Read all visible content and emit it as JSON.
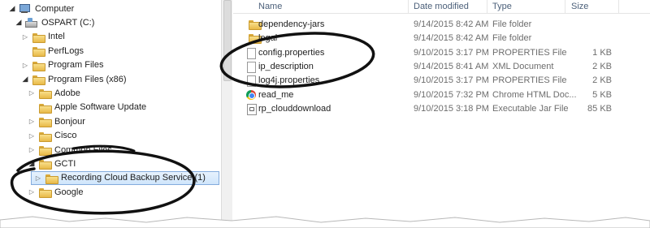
{
  "tree": {
    "items": [
      {
        "label": "Computer",
        "icon": "computer-icon",
        "arrow": "open",
        "indent": 0
      },
      {
        "label": "OSPART (C:)",
        "icon": "drive-icon",
        "arrow": "open",
        "indent": 1
      },
      {
        "label": "Intel",
        "icon": "folder-icon",
        "arrow": "closed",
        "indent": 2
      },
      {
        "label": "PerfLogs",
        "icon": "folder-icon",
        "arrow": "none",
        "indent": 2
      },
      {
        "label": "Program Files",
        "icon": "folder-icon",
        "arrow": "closed",
        "indent": 2
      },
      {
        "label": "Program Files (x86)",
        "icon": "folder-icon",
        "arrow": "open",
        "indent": 2
      },
      {
        "label": "Adobe",
        "icon": "folder-icon",
        "arrow": "closed",
        "indent": 3
      },
      {
        "label": "Apple Software Update",
        "icon": "folder-icon",
        "arrow": "none",
        "indent": 3
      },
      {
        "label": "Bonjour",
        "icon": "folder-icon",
        "arrow": "closed",
        "indent": 3
      },
      {
        "label": "Cisco",
        "icon": "folder-icon",
        "arrow": "closed",
        "indent": 3
      },
      {
        "label": "Common Files",
        "icon": "folder-icon",
        "arrow": "closed",
        "indent": 3
      },
      {
        "label": "GCTI",
        "icon": "folder-icon",
        "arrow": "open",
        "indent": 3
      },
      {
        "label": "Recording Cloud Backup Service (1)",
        "icon": "folder-icon",
        "arrow": "closed",
        "indent": 4,
        "selected": true
      },
      {
        "label": "Google",
        "icon": "folder-icon",
        "arrow": "closed",
        "indent": 3
      }
    ]
  },
  "columns": {
    "name": "Name",
    "date": "Date modified",
    "type": "Type",
    "size": "Size"
  },
  "files": [
    {
      "name": "dependency-jars",
      "date": "9/14/2015 8:42 AM",
      "type": "File folder",
      "size": "",
      "icon": "folder-icon"
    },
    {
      "name": "legal",
      "date": "9/14/2015 8:42 AM",
      "type": "File folder",
      "size": "",
      "icon": "folder-icon"
    },
    {
      "name": "config.properties",
      "date": "9/10/2015 3:17 PM",
      "type": "PROPERTIES File",
      "size": "1 KB",
      "icon": "document-icon"
    },
    {
      "name": "ip_description",
      "date": "9/14/2015 8:41 AM",
      "type": "XML Document",
      "size": "2 KB",
      "icon": "document-icon"
    },
    {
      "name": "log4j.properties",
      "date": "9/10/2015 3:17 PM",
      "type": "PROPERTIES File",
      "size": "2 KB",
      "icon": "document-icon"
    },
    {
      "name": "read_me",
      "date": "9/10/2015 7:32 PM",
      "type": "Chrome HTML Doc...",
      "size": "5 KB",
      "icon": "chrome-icon"
    },
    {
      "name": "rp_clouddownload",
      "date": "9/10/2015 3:18 PM",
      "type": "Executable Jar File",
      "size": "85 KB",
      "icon": "jar-icon"
    }
  ]
}
